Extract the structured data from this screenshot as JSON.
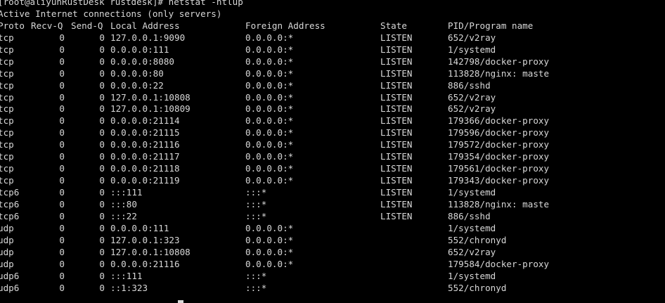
{
  "terminal": {
    "top_partial": "                                                                                                          ",
    "prompt": "[root@aliyunRustDesk rustdesk]# netstat -ntlup",
    "heading": "Active Internet connections (only servers)",
    "columns": {
      "proto": "Proto",
      "recv": "Recv-Q",
      "send": "Send-Q",
      "local": "Local Address",
      "foreign": "Foreign Address",
      "state": "State",
      "pid": "PID/Program name"
    },
    "rows": [
      {
        "proto": "tcp",
        "recv": "0",
        "send": "0",
        "local": "127.0.0.1:9090",
        "foreign": "0.0.0.0:*",
        "state": "LISTEN",
        "pid": "652/v2ray"
      },
      {
        "proto": "tcp",
        "recv": "0",
        "send": "0",
        "local": "0.0.0.0:111",
        "foreign": "0.0.0.0:*",
        "state": "LISTEN",
        "pid": "1/systemd"
      },
      {
        "proto": "tcp",
        "recv": "0",
        "send": "0",
        "local": "0.0.0.0:8080",
        "foreign": "0.0.0.0:*",
        "state": "LISTEN",
        "pid": "142798/docker-proxy"
      },
      {
        "proto": "tcp",
        "recv": "0",
        "send": "0",
        "local": "0.0.0.0:80",
        "foreign": "0.0.0.0:*",
        "state": "LISTEN",
        "pid": "113828/nginx: maste"
      },
      {
        "proto": "tcp",
        "recv": "0",
        "send": "0",
        "local": "0.0.0.0:22",
        "foreign": "0.0.0.0:*",
        "state": "LISTEN",
        "pid": "886/sshd"
      },
      {
        "proto": "tcp",
        "recv": "0",
        "send": "0",
        "local": "127.0.0.1:10808",
        "foreign": "0.0.0.0:*",
        "state": "LISTEN",
        "pid": "652/v2ray"
      },
      {
        "proto": "tcp",
        "recv": "0",
        "send": "0",
        "local": "127.0.0.1:10809",
        "foreign": "0.0.0.0:*",
        "state": "LISTEN",
        "pid": "652/v2ray"
      },
      {
        "proto": "tcp",
        "recv": "0",
        "send": "0",
        "local": "0.0.0.0:21114",
        "foreign": "0.0.0.0:*",
        "state": "LISTEN",
        "pid": "179366/docker-proxy"
      },
      {
        "proto": "tcp",
        "recv": "0",
        "send": "0",
        "local": "0.0.0.0:21115",
        "foreign": "0.0.0.0:*",
        "state": "LISTEN",
        "pid": "179596/docker-proxy"
      },
      {
        "proto": "tcp",
        "recv": "0",
        "send": "0",
        "local": "0.0.0.0:21116",
        "foreign": "0.0.0.0:*",
        "state": "LISTEN",
        "pid": "179572/docker-proxy"
      },
      {
        "proto": "tcp",
        "recv": "0",
        "send": "0",
        "local": "0.0.0.0:21117",
        "foreign": "0.0.0.0:*",
        "state": "LISTEN",
        "pid": "179354/docker-proxy"
      },
      {
        "proto": "tcp",
        "recv": "0",
        "send": "0",
        "local": "0.0.0.0:21118",
        "foreign": "0.0.0.0:*",
        "state": "LISTEN",
        "pid": "179561/docker-proxy"
      },
      {
        "proto": "tcp",
        "recv": "0",
        "send": "0",
        "local": "0.0.0.0:21119",
        "foreign": "0.0.0.0:*",
        "state": "LISTEN",
        "pid": "179343/docker-proxy"
      },
      {
        "proto": "tcp6",
        "recv": "0",
        "send": "0",
        "local": ":::111",
        "foreign": ":::*",
        "state": "LISTEN",
        "pid": "1/systemd"
      },
      {
        "proto": "tcp6",
        "recv": "0",
        "send": "0",
        "local": ":::80",
        "foreign": ":::*",
        "state": "LISTEN",
        "pid": "113828/nginx: maste"
      },
      {
        "proto": "tcp6",
        "recv": "0",
        "send": "0",
        "local": ":::22",
        "foreign": ":::*",
        "state": "LISTEN",
        "pid": "886/sshd"
      },
      {
        "proto": "udp",
        "recv": "0",
        "send": "0",
        "local": "0.0.0.0:111",
        "foreign": "0.0.0.0:*",
        "state": "",
        "pid": "1/systemd"
      },
      {
        "proto": "udp",
        "recv": "0",
        "send": "0",
        "local": "127.0.0.1:323",
        "foreign": "0.0.0.0:*",
        "state": "",
        "pid": "552/chronyd"
      },
      {
        "proto": "udp",
        "recv": "0",
        "send": "0",
        "local": "127.0.0.1:10808",
        "foreign": "0.0.0.0:*",
        "state": "",
        "pid": "652/v2ray"
      },
      {
        "proto": "udp",
        "recv": "0",
        "send": "0",
        "local": "0.0.0.0:21116",
        "foreign": "0.0.0.0:*",
        "state": "",
        "pid": "179584/docker-proxy"
      },
      {
        "proto": "udp6",
        "recv": "0",
        "send": "0",
        "local": ":::111",
        "foreign": ":::*",
        "state": "",
        "pid": "1/systemd"
      },
      {
        "proto": "udp6",
        "recv": "0",
        "send": "0",
        "local": "::1:323",
        "foreign": ":::*",
        "state": "",
        "pid": "552/chronyd"
      }
    ],
    "colors": {
      "background": "#000000",
      "foreground": "#d8d8d8"
    }
  }
}
